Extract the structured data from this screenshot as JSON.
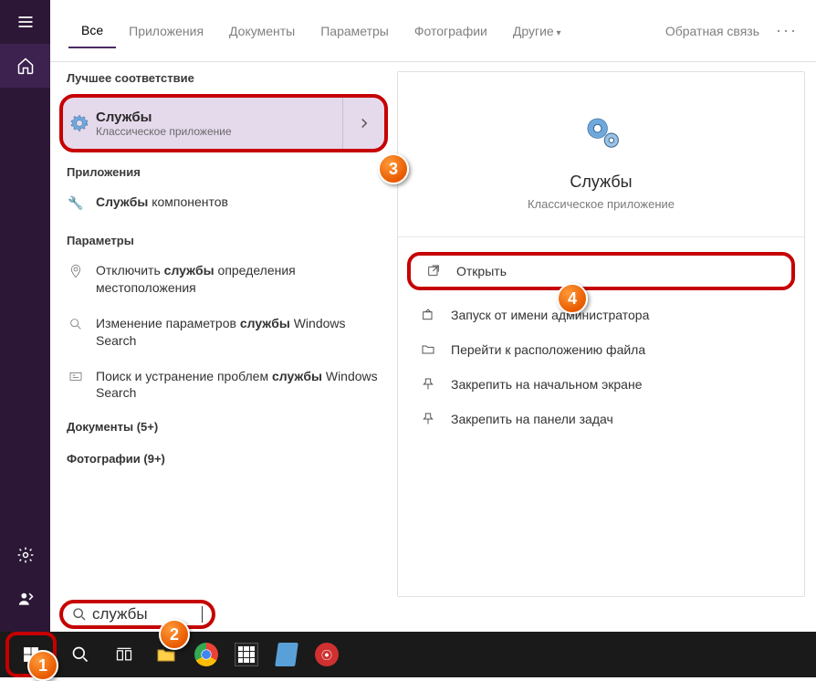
{
  "tabs": {
    "all": "Все",
    "apps": "Приложения",
    "docs": "Документы",
    "params": "Параметры",
    "photos": "Фотографии",
    "other": "Другие",
    "feedback": "Обратная связь"
  },
  "sections": {
    "best": "Лучшее соответствие",
    "apps": "Приложения",
    "params": "Параметры",
    "docs": "Документы (5+)",
    "photos": "Фотографии (9+)"
  },
  "best": {
    "title": "Службы",
    "subtitle": "Классическое приложение"
  },
  "apps": {
    "item0_pre": "",
    "item0_bold": "Службы",
    "item0_post": " компонентов"
  },
  "params": {
    "item0_pre": "Отключить ",
    "item0_bold": "службы",
    "item0_post": " определения местоположения",
    "item1_pre": "Изменение параметров ",
    "item1_bold": "службы",
    "item1_post": " Windows Search",
    "item2_pre": "Поиск и устранение проблем ",
    "item2_bold": "службы",
    "item2_post": " Windows Search"
  },
  "detail": {
    "title": "Службы",
    "subtitle": "Классическое приложение"
  },
  "actions": {
    "open": "Открыть",
    "runas": "Запуск от имени администратора",
    "location": "Перейти к расположению файла",
    "pin_start": "Закрепить на начальном экране",
    "pin_tb": "Закрепить на панели задач"
  },
  "search": {
    "value": "службы"
  },
  "badges": {
    "1": "1",
    "2": "2",
    "3": "3",
    "4": "4"
  }
}
